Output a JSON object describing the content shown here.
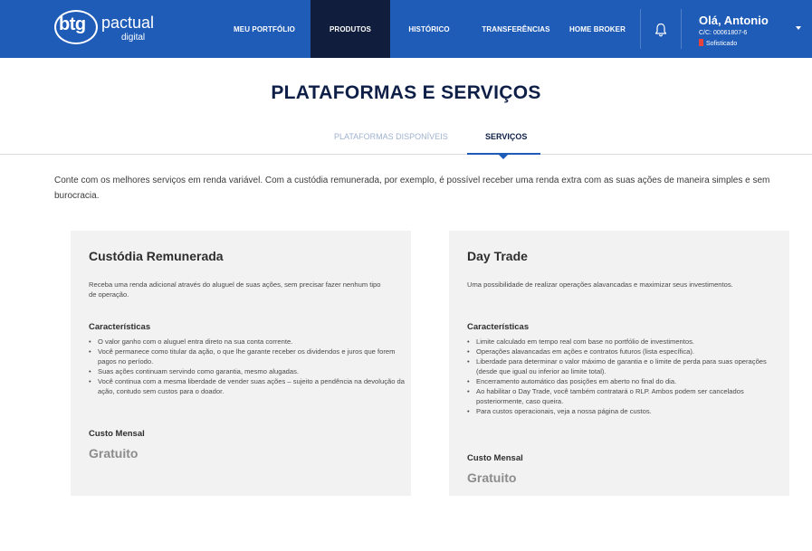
{
  "brand": {
    "logo_mark": "btg",
    "logo_word": "pactual",
    "logo_sub": "digital",
    "header_color": "#1f5cb8",
    "active_nav_color": "#101d3d"
  },
  "nav": {
    "items": [
      {
        "label": "MEU PORTFÓLIO",
        "active": false
      },
      {
        "label": "PRODUTOS",
        "active": true
      },
      {
        "label": "HISTÓRICO",
        "active": false
      },
      {
        "label": "TRANSFERÊNCIAS",
        "active": false
      },
      {
        "label": "HOME BROKER",
        "active": false
      }
    ],
    "notification_icon": "bell-icon"
  },
  "user": {
    "greeting": "Olá, Antonio",
    "account": "C/C: 00061807-6",
    "profile": "Sofisticado",
    "profile_color": "#e8433a",
    "menu_icon": "chevron-down-icon"
  },
  "page": {
    "title": "PLATAFORMAS E SERVIÇOS",
    "tabs": [
      {
        "label": "PLATAFORMAS DISPONÍVEIS",
        "active": false
      },
      {
        "label": "SERVIÇOS",
        "active": true
      }
    ],
    "intro": "Conte com os melhores serviços em renda variável. Com a custódia remunerada, por exemplo, é possível receber uma renda extra com as suas ações de maneira simples e sem burocracia."
  },
  "cards": [
    {
      "title": "Custódia Remunerada",
      "description": "Receba uma renda adicional através do aluguel de suas ações, sem precisar fazer nenhum tipo de operação.",
      "features_title": "Características",
      "features": [
        "O valor ganho com o aluguel entra direto na sua conta corrente.",
        "Você permanece como titular da ação, o que lhe garante receber os dividendos e juros que forem pagos no período.",
        "Suas ações continuam servindo como garantia, mesmo alugadas.",
        "Você continua com a mesma liberdade de vender suas ações – sujeito a pendência na devolução da ação, contudo sem custos para o doador."
      ],
      "cost_label": "Custo Mensal",
      "cost_value": "Gratuito"
    },
    {
      "title": "Day Trade",
      "description": "Uma possibilidade de realizar operações alavancadas e maximizar seus investimentos.",
      "features_title": "Características",
      "features": [
        "Limite calculado em tempo real com base no portfólio de investimentos.",
        "Operações alavancadas em ações e contratos futuros (lista específica).",
        "Liberdade para determinar o valor máximo de garantia e o limite de perda para suas operações (desde que igual ou inferior ao limite total).",
        "Encerramento automático das posições em aberto no final do dia.",
        "Ao habilitar o Day Trade, você também contratará o RLP. Ambos podem ser cancelados posteriormente, caso queira.",
        "Para custos operacionais, veja a nossa página de custos."
      ],
      "cost_label": "Custo Mensal",
      "cost_value": "Gratuito"
    }
  ]
}
